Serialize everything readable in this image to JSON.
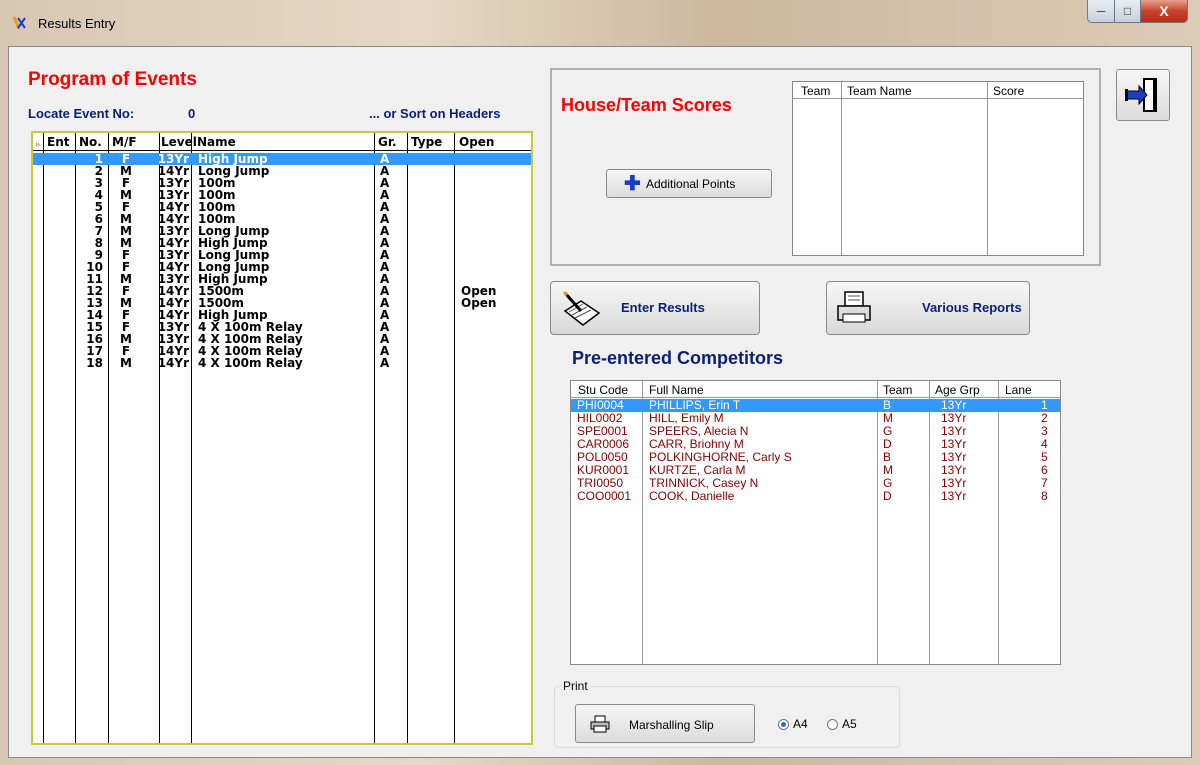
{
  "window": {
    "title": "Results Entry",
    "close_glyph": "X"
  },
  "program": {
    "title": "Program of Events",
    "locate_label": "Locate Event No:",
    "locate_value": "0",
    "sort_hint": "... or Sort on Headers",
    "columns": [
      "Ent",
      "No.",
      "M/F",
      "Level",
      "Name",
      "Gr.",
      "Type",
      "Open"
    ],
    "rows": [
      {
        "no": "1",
        "mf": "F",
        "level": "13Yr",
        "name": "High Jump",
        "gr": "A",
        "open": ""
      },
      {
        "no": "2",
        "mf": "M",
        "level": "14Yr",
        "name": "Long Jump",
        "gr": "A",
        "open": ""
      },
      {
        "no": "3",
        "mf": "F",
        "level": "13Yr",
        "name": "100m",
        "gr": "A",
        "open": ""
      },
      {
        "no": "4",
        "mf": "M",
        "level": "13Yr",
        "name": "100m",
        "gr": "A",
        "open": ""
      },
      {
        "no": "5",
        "mf": "F",
        "level": "14Yr",
        "name": "100m",
        "gr": "A",
        "open": ""
      },
      {
        "no": "6",
        "mf": "M",
        "level": "14Yr",
        "name": "100m",
        "gr": "A",
        "open": ""
      },
      {
        "no": "7",
        "mf": "M",
        "level": "13Yr",
        "name": "Long Jump",
        "gr": "A",
        "open": ""
      },
      {
        "no": "8",
        "mf": "M",
        "level": "14Yr",
        "name": "High Jump",
        "gr": "A",
        "open": ""
      },
      {
        "no": "9",
        "mf": "F",
        "level": "13Yr",
        "name": "Long Jump",
        "gr": "A",
        "open": ""
      },
      {
        "no": "10",
        "mf": "F",
        "level": "14Yr",
        "name": "Long Jump",
        "gr": "A",
        "open": ""
      },
      {
        "no": "11",
        "mf": "M",
        "level": "13Yr",
        "name": "High Jump",
        "gr": "A",
        "open": ""
      },
      {
        "no": "12",
        "mf": "F",
        "level": "14Yr",
        "name": "1500m",
        "gr": "A",
        "open": "Open"
      },
      {
        "no": "13",
        "mf": "M",
        "level": "14Yr",
        "name": "1500m",
        "gr": "A",
        "open": "Open"
      },
      {
        "no": "14",
        "mf": "F",
        "level": "14Yr",
        "name": "High Jump",
        "gr": "A",
        "open": ""
      },
      {
        "no": "15",
        "mf": "F",
        "level": "13Yr",
        "name": "4 X 100m Relay",
        "gr": "A",
        "open": ""
      },
      {
        "no": "16",
        "mf": "M",
        "level": "13Yr",
        "name": "4 X 100m Relay",
        "gr": "A",
        "open": ""
      },
      {
        "no": "17",
        "mf": "F",
        "level": "14Yr",
        "name": "4 X 100m Relay",
        "gr": "A",
        "open": ""
      },
      {
        "no": "18",
        "mf": "M",
        "level": "14Yr",
        "name": "4 X 100m Relay",
        "gr": "A",
        "open": ""
      }
    ],
    "selected_row": 0
  },
  "house": {
    "title": "House/Team Scores",
    "additional_points_label": "Additional Points",
    "columns": [
      "Team",
      "Team Name",
      "Score"
    ]
  },
  "actions": {
    "enter_results": "Enter Results",
    "various_reports": "Various Reports"
  },
  "competitors": {
    "title": "Pre-entered Competitors",
    "columns": [
      "Stu Code",
      "Full Name",
      "Team",
      "Age Grp",
      "Lane"
    ],
    "rows": [
      {
        "code": "PHI0004",
        "name": "PHILLIPS, Erin T",
        "team": "B",
        "age": "13Yr",
        "lane": "1"
      },
      {
        "code": "HIL0002",
        "name": "HILL, Emily M",
        "team": "M",
        "age": "13Yr",
        "lane": "2"
      },
      {
        "code": "SPE0001",
        "name": "SPEERS, Alecia N",
        "team": "G",
        "age": "13Yr",
        "lane": "3"
      },
      {
        "code": "CAR0006",
        "name": "CARR, Briohny M",
        "team": "D",
        "age": "13Yr",
        "lane": "4"
      },
      {
        "code": "POL0050",
        "name": "POLKINGHORNE, Carly S",
        "team": "B",
        "age": "13Yr",
        "lane": "5"
      },
      {
        "code": "KUR0001",
        "name": "KURTZE, Carla M",
        "team": "M",
        "age": "13Yr",
        "lane": "6"
      },
      {
        "code": "TRI0050",
        "name": "TRINNICK, Casey N",
        "team": "G",
        "age": "13Yr",
        "lane": "7"
      },
      {
        "code": "COO0001",
        "name": "COOK, Danielle",
        "team": "D",
        "age": "13Yr",
        "lane": "8"
      }
    ],
    "selected_row": 0
  },
  "print": {
    "legend": "Print",
    "marshalling_label": "Marshalling Slip",
    "options": [
      "A4",
      "A5"
    ],
    "selected": "A4"
  },
  "colors": {
    "heading_red": "#ff0000",
    "navy": "#0a1f78",
    "selection": "#3399ff",
    "competitor_text": "#8b0000"
  }
}
